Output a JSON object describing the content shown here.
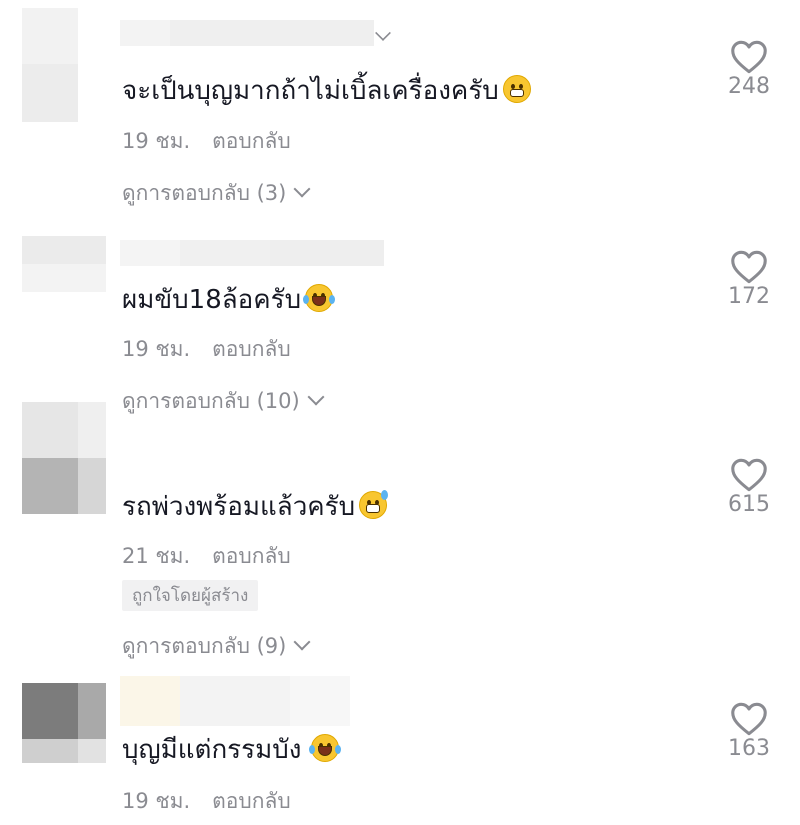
{
  "comments": [
    {
      "text": "จะเป็นบุญมากถ้าไม่เบิ้ลเครื่องครับ",
      "emoji": "grimacing-face-emoji",
      "time": "19 ชม.",
      "reply": "ตอบกลับ",
      "view_replies": "ดูการตอบกลับ (3)",
      "likes": "248"
    },
    {
      "text": "ผมขับ18ล้อครับ",
      "emoji": "face-with-tears-of-joy-emoji",
      "time": "19 ชม.",
      "reply": "ตอบกลับ",
      "view_replies": "ดูการตอบกลับ (10)",
      "likes": "172"
    },
    {
      "text": "รถพ่วงพร้อมแล้วครับ",
      "emoji": "grinning-face-with-sweat-emoji",
      "time": "21 ชม.",
      "reply": "ตอบกลับ",
      "badge": "ถูกใจโดยผู้สร้าง",
      "view_replies": "ดูการตอบกลับ (9)",
      "likes": "615"
    },
    {
      "text": "บุญมีแต่กรรมบัง",
      "emoji": "face-with-tears-of-joy-emoji",
      "time": "19 ชม.",
      "reply": "ตอบกลับ",
      "likes": "163"
    }
  ],
  "colors": {
    "text": "#161823",
    "secondary": "#8a8b91",
    "emoji_yellow": "#f8c630",
    "badge_bg": "#f1f1f2"
  }
}
